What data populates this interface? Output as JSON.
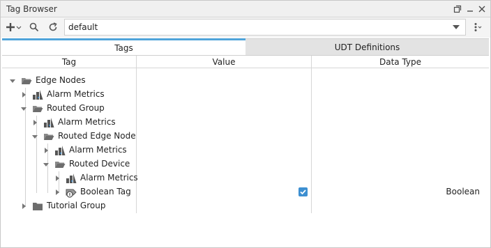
{
  "window": {
    "title": "Tag Browser"
  },
  "toolbar": {
    "provider_value": "default"
  },
  "tabs": [
    {
      "label": "Tags",
      "active": true
    },
    {
      "label": "UDT Definitions",
      "active": false
    }
  ],
  "columns": {
    "tag": "Tag",
    "value": "Value",
    "data_type": "Data Type"
  },
  "tree": {
    "edge_nodes": "Edge Nodes",
    "alarm_metrics_1": "Alarm Metrics",
    "routed_group": "Routed Group",
    "alarm_metrics_2": "Alarm Metrics",
    "routed_edge_node": "Routed Edge Node",
    "alarm_metrics_3": "Alarm Metrics",
    "routed_device": "Routed Device",
    "alarm_metrics_4": "Alarm Metrics",
    "boolean_tag": "Boolean Tag",
    "boolean_tag_value": true,
    "boolean_tag_type": "Boolean",
    "tutorial_group": "Tutorial Group"
  },
  "colors": {
    "accent": "#4fa3d9",
    "checkbox": "#3d8fd1",
    "folder": "#6d6d6d"
  }
}
